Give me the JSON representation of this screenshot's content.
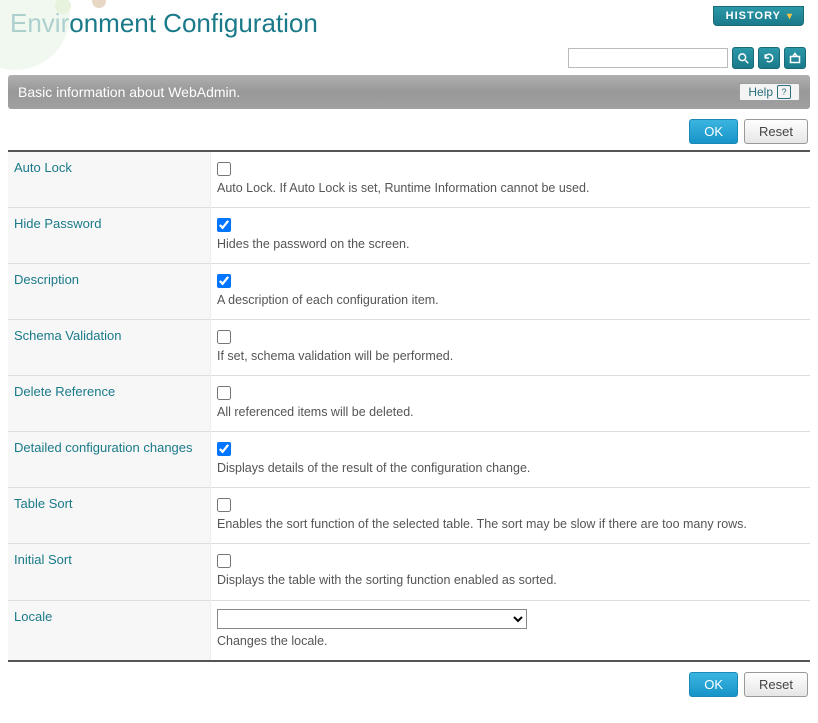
{
  "header": {
    "title": "Environment Configuration",
    "history_label": "HISTORY"
  },
  "search": {
    "value": "",
    "placeholder": ""
  },
  "banner": {
    "text": "Basic information about WebAdmin.",
    "help_label": "Help"
  },
  "buttons": {
    "ok": "OK",
    "reset": "Reset"
  },
  "rows": [
    {
      "label": "Auto Lock",
      "checked": false,
      "desc": "Auto Lock. If Auto Lock is set, Runtime Information cannot be used."
    },
    {
      "label": "Hide Password",
      "checked": true,
      "desc": "Hides the password on the screen."
    },
    {
      "label": "Description",
      "checked": true,
      "desc": "A description of each configuration item."
    },
    {
      "label": "Schema Validation",
      "checked": false,
      "desc": "If set, schema validation will be performed."
    },
    {
      "label": "Delete Reference",
      "checked": false,
      "desc": "All referenced items will be deleted."
    },
    {
      "label": "Detailed configuration changes",
      "checked": true,
      "desc": "Displays details of the result of the configuration change."
    },
    {
      "label": "Table Sort",
      "checked": false,
      "desc": "Enables the sort function of the selected table. The sort may be slow if there are too many rows."
    },
    {
      "label": "Initial Sort",
      "checked": false,
      "desc": "Displays the table with the sorting function enabled as sorted."
    }
  ],
  "locale": {
    "label": "Locale",
    "value": "",
    "desc": "Changes the locale."
  }
}
